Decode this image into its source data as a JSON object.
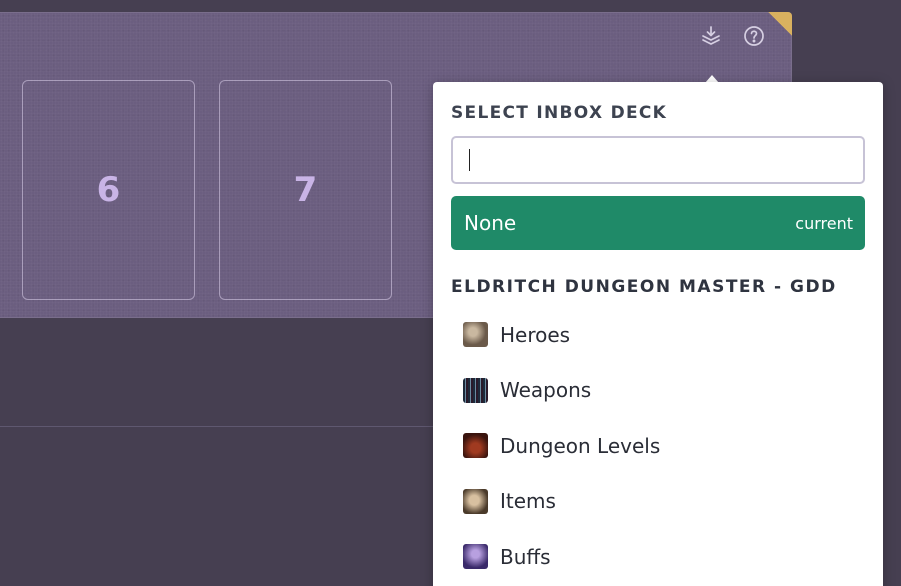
{
  "board": {
    "slots": [
      {
        "label": "6"
      },
      {
        "label": "7"
      }
    ]
  },
  "toolbar": {
    "inbox_icon": "inbox-download-icon",
    "help_icon": "help-circle-icon"
  },
  "popover": {
    "title": "SELECT INBOX DECK",
    "search": {
      "value": "",
      "placeholder": ""
    },
    "none_option": {
      "label": "None",
      "badge": "current"
    },
    "group_title": "ELDRITCH DUNGEON MASTER - GDD",
    "decks": [
      {
        "label": "Heroes",
        "thumb_color": "#6b5a4a"
      },
      {
        "label": "Weapons",
        "thumb_color": "#1c2a3a"
      },
      {
        "label": "Dungeon Levels",
        "thumb_color": "#5a1e14"
      },
      {
        "label": "Items",
        "thumb_color": "#6a5a44"
      },
      {
        "label": "Buffs",
        "thumb_color": "#4a3a7a"
      }
    ]
  },
  "colors": {
    "background": "#463f51",
    "board": "#6b5e80",
    "selected": "#1f8a68",
    "corner_accent": "#d9b15f"
  }
}
